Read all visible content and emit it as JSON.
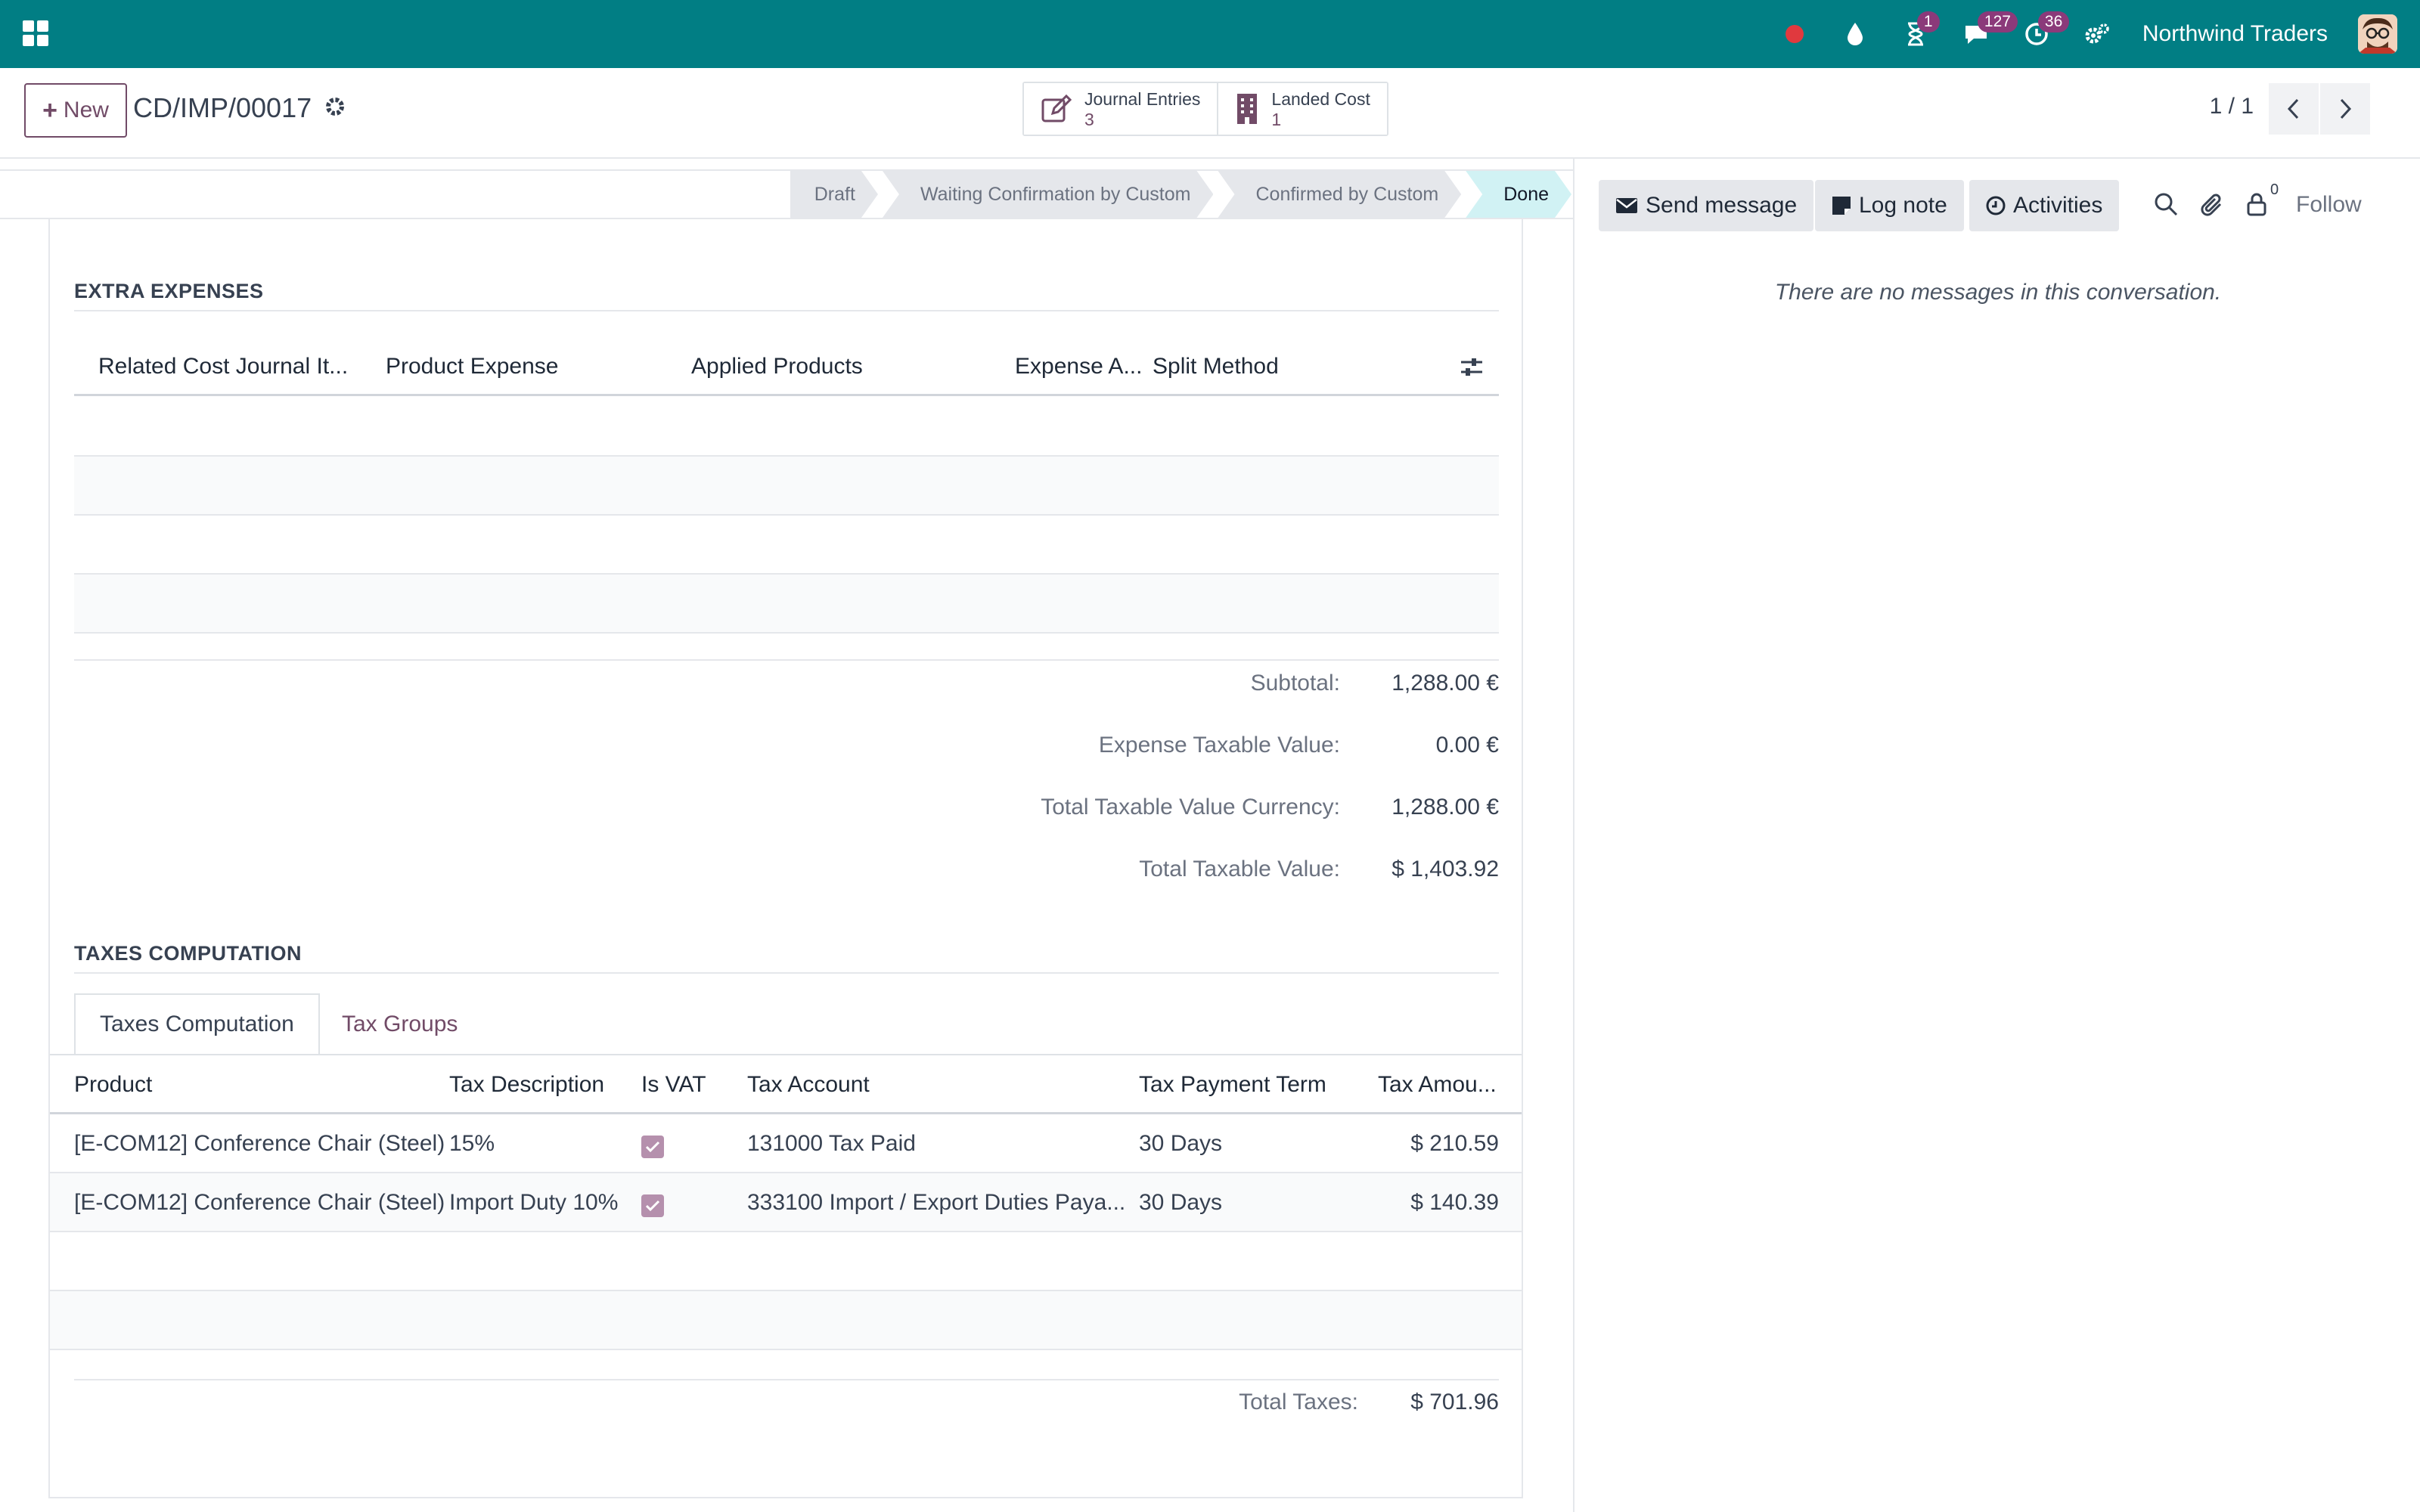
{
  "navbar": {
    "company": "Northwind Traders",
    "badges": {
      "activities": "1",
      "messages": "127",
      "clock": "36"
    }
  },
  "control_panel": {
    "new_button": "New",
    "record_name": "CD/IMP/00017",
    "smart_buttons": [
      {
        "label": "Journal Entries",
        "value": "3"
      },
      {
        "label": "Landed Cost",
        "value": "1"
      }
    ],
    "pager": "1 / 1"
  },
  "statusbar": {
    "stages": [
      "Draft",
      "Waiting Confirmation by Custom",
      "Confirmed by Custom",
      "Done"
    ],
    "active": "Done"
  },
  "extra_expenses": {
    "title": "EXTRA EXPENSES",
    "columns": [
      "Related Cost Journal It...",
      "Product Expense",
      "Applied Products",
      "Expense A...",
      "Split Method"
    ]
  },
  "totals": {
    "subtotal_label": "Subtotal:",
    "subtotal": "1,288.00 €",
    "expense_taxable_label": "Expense Taxable Value:",
    "expense_taxable": "0.00 €",
    "total_taxable_currency_label": "Total Taxable Value Currency:",
    "total_taxable_currency": "1,288.00 €",
    "total_taxable_label": "Total Taxable Value:",
    "total_taxable": "$ 1,403.92"
  },
  "taxes": {
    "title": "TAXES COMPUTATION",
    "tabs": [
      "Taxes Computation",
      "Tax Groups"
    ],
    "columns": [
      "Product",
      "Tax Description",
      "Is VAT",
      "Tax Account",
      "Tax Payment Term",
      "Tax Amou..."
    ],
    "rows": [
      {
        "product": "[E-COM12] Conference Chair (Steel)",
        "description": "15%",
        "is_vat": true,
        "account": "131000 Tax Paid",
        "term": "30 Days",
        "amount": "$ 210.59"
      },
      {
        "product": "[E-COM12] Conference Chair (Steel)",
        "description": "Import Duty 10%",
        "is_vat": true,
        "account": "333100 Import / Export Duties Paya...",
        "term": "30 Days",
        "amount": "$ 140.39"
      }
    ],
    "total_label": "Total Taxes:",
    "total": "$ 701.96"
  },
  "chatter": {
    "send_message": "Send message",
    "log_note": "Log note",
    "activities": "Activities",
    "followers_count": "0",
    "follow": "Follow",
    "empty": "There are no messages in this conversation."
  },
  "colors": {
    "brand": "#017e84",
    "accent": "#714b67",
    "stage_active": "#d1f2f4"
  }
}
